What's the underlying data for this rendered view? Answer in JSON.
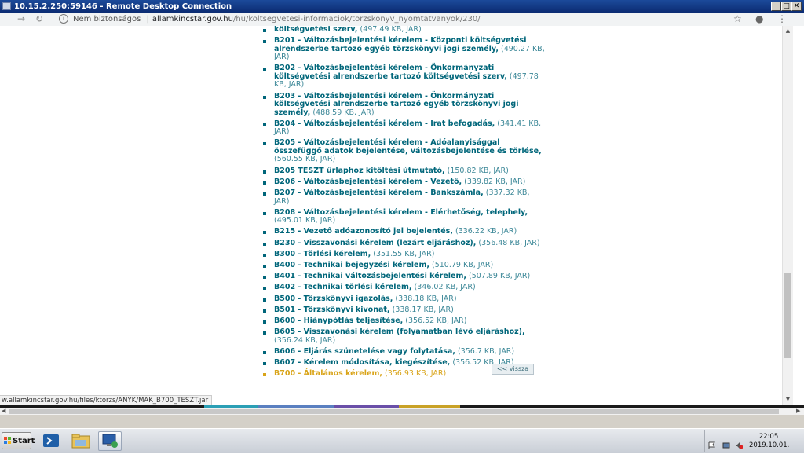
{
  "window": {
    "title": "10.15.2.250:59146 - Remote Desktop Connection",
    "controls": {
      "minimize": "_",
      "maximize": "□",
      "close": "✕"
    }
  },
  "browser": {
    "security_label": "Nem biztonságos",
    "url_host": "allamkincstar.gov.hu",
    "url_path": "/hu/koltsegvetesi-informaciok/torzskonyv_nyomtatvanyok/230/",
    "icons": [
      "back-arrow-icon",
      "reload-icon",
      "info-icon",
      "star-icon",
      "profile-icon",
      "menu-dots-icon"
    ]
  },
  "documents": [
    {
      "title": "költségvetési szerv,",
      "meta": "(497.49 KB, JAR)",
      "highlight": false,
      "continuation": true
    },
    {
      "title": "B201 - Változásbejelentési kérelem - Központi költségvetési alrendszerbe tartozó egyéb törzskönyvi jogi személy,",
      "meta": "(490.27 KB, JAR)",
      "highlight": false
    },
    {
      "title": "B202 - Változásbejelentési kérelem - Önkormányzati költségvetési alrendszerbe tartozó költségvetési szerv,",
      "meta": "(497.78 KB, JAR)",
      "highlight": false
    },
    {
      "title": "B203 - Változásbejelentési kérelem - Önkormányzati költségvetési alrendszerbe tartozó egyéb törzskönyvi jogi személy,",
      "meta": "(488.59 KB, JAR)",
      "highlight": false
    },
    {
      "title": "B204 - Változásbejelentési kérelem - Irat befogadás,",
      "meta": "(341.41 KB, JAR)",
      "highlight": false
    },
    {
      "title": "B205 - Változásbejelentési kérelem - Adóalanyisággal összefüggő adatok bejelentése, változásbejelentése és törlése,",
      "meta": "(560.55 KB, JAR)",
      "highlight": false
    },
    {
      "title": "B205 TESZT űrlaphoz kitöltési útmutató,",
      "meta": "(150.82 KB, JAR)",
      "highlight": false
    },
    {
      "title": "B206 - Változásbejelentési kérelem - Vezető,",
      "meta": "(339.82 KB, JAR)",
      "highlight": false
    },
    {
      "title": "B207 - Változásbejelentési kérelem - Bankszámla,",
      "meta": "(337.32 KB, JAR)",
      "highlight": false
    },
    {
      "title": "B208 - Változásbejelentési kérelem - Elérhetőség, telephely,",
      "meta": "(495.01 KB, JAR)",
      "highlight": false
    },
    {
      "title": "B215 - Vezető adóazonosító jel bejelentés,",
      "meta": "(336.22 KB, JAR)",
      "highlight": false
    },
    {
      "title": "B230 - Visszavonási kérelem (lezárt eljáráshoz),",
      "meta": "(356.48 KB, JAR)",
      "highlight": false
    },
    {
      "title": "B300 - Törlési kérelem,",
      "meta": "(351.55 KB, JAR)",
      "highlight": false
    },
    {
      "title": "B400 - Technikai bejegyzési kérelem,",
      "meta": "(510.79 KB, JAR)",
      "highlight": false
    },
    {
      "title": "B401 - Technikai változásbejelentési kérelem,",
      "meta": "(507.89 KB, JAR)",
      "highlight": false
    },
    {
      "title": "B402 - Technikai törlési kérelem,",
      "meta": "(346.02 KB, JAR)",
      "highlight": false
    },
    {
      "title": "B500 - Törzskönyvi igazolás,",
      "meta": "(338.18 KB, JAR)",
      "highlight": false
    },
    {
      "title": "B501 - Törzskönyvi kivonat,",
      "meta": "(338.17 KB, JAR)",
      "highlight": false
    },
    {
      "title": "B600 - Hiánypótlás teljesítése,",
      "meta": "(356.52 KB, JAR)",
      "highlight": false
    },
    {
      "title": "B605 - Visszavonási kérelem (folyamatban lévő eljáráshoz),",
      "meta": "(356.24 KB, JAR)",
      "highlight": false
    },
    {
      "title": "B606 - Eljárás szünetelése vagy folytatása,",
      "meta": "(356.7 KB, JAR)",
      "highlight": false
    },
    {
      "title": "B607 - Kérelem módosítása, kiegészítése,",
      "meta": "(356.52 KB, JAR)",
      "highlight": false
    },
    {
      "title": "B700 - Általános kérelem,",
      "meta": "(356.93 KB, JAR)",
      "highlight": true
    }
  ],
  "back_button": "<< vissza",
  "status_url": "w.allamkincstar.gov.hu/files/ktorzs/ANYK/MAK_B700_TESZT.jar",
  "taskbar": {
    "start_label": "Start",
    "apps": [
      "powershell-icon",
      "file-explorer-icon",
      "remote-desktop-icon"
    ],
    "clock_time": "22:05",
    "clock_date": "2019.10.01."
  },
  "colors": {
    "link": "#00667a",
    "highlight": "#d9a419",
    "band": [
      "#1a1a1a",
      "#2b9fb5",
      "#2b9fb5",
      "#5a7fc0",
      "#6a4fa8",
      "#c9a227"
    ]
  }
}
